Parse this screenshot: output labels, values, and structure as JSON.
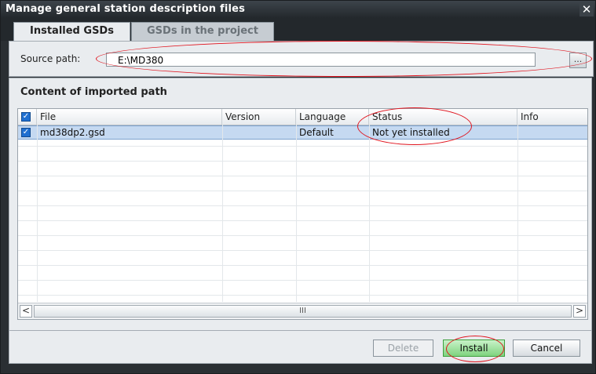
{
  "window": {
    "title": "Manage general station description files",
    "close_glyph": "✕"
  },
  "tabs": [
    {
      "label": "Installed GSDs",
      "active": true
    },
    {
      "label": "GSDs in the project",
      "active": false
    }
  ],
  "source": {
    "label": "Source path:",
    "value": "E:\\MD380",
    "browse_label": "..."
  },
  "content": {
    "heading": "Content of imported path",
    "columns": [
      "File",
      "Version",
      "Language",
      "Status",
      "Info"
    ],
    "rows": [
      {
        "checked": true,
        "file": "md38dp2.gsd",
        "version": "",
        "language": "Default",
        "status": "Not yet installed",
        "info": ""
      }
    ],
    "scroll_left": "<",
    "scroll_right": ">",
    "scroll_thumb": "III"
  },
  "buttons": {
    "delete": "Delete",
    "install": "Install",
    "cancel": "Cancel"
  },
  "colors": {
    "annotation_red": "#e0141e",
    "selected_row": "#c5d9f1",
    "install_green": "#7fd37f"
  }
}
